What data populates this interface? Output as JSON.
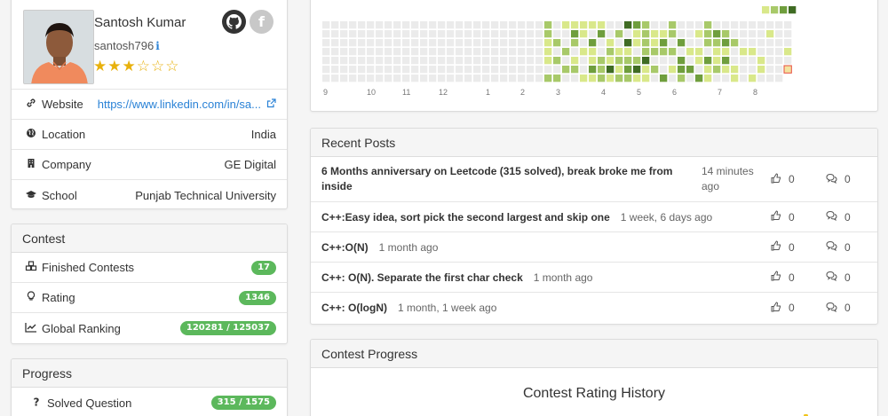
{
  "profile": {
    "real_name": "Santosh Kumar",
    "username": "santosh796",
    "stars": {
      "filled": 3,
      "total": 6
    },
    "rows": [
      {
        "label": "Website",
        "value": "https://www.linkedin.com/in/sa...",
        "icon": "link-icon"
      },
      {
        "label": "Location",
        "value": "India",
        "icon": "globe-icon"
      },
      {
        "label": "Company",
        "value": "GE Digital",
        "icon": "building-icon"
      },
      {
        "label": "School",
        "value": "Punjab Technical University",
        "icon": "graduation-cap-icon"
      }
    ]
  },
  "contest": {
    "heading": "Contest",
    "rows": [
      {
        "label": "Finished Contests",
        "value": "17",
        "icon": "cubes-icon"
      },
      {
        "label": "Rating",
        "value": "1346",
        "icon": "lightbulb-icon"
      },
      {
        "label": "Global Ranking",
        "value": "120281 / 125037",
        "icon": "line-chart-icon"
      }
    ]
  },
  "progress": {
    "heading": "Progress",
    "rows": [
      {
        "label": "Solved Question",
        "value": "315 / 1575",
        "icon": "question-icon"
      }
    ]
  },
  "heatmap": {
    "month_labels": [
      "9",
      "10",
      "11",
      "12",
      "1",
      "2",
      "3",
      "4",
      "5",
      "6",
      "7",
      "8"
    ],
    "colors": [
      "#ebebeb",
      "#d9e88a",
      "#a8c969",
      "#6f9e3d",
      "#3f6b23"
    ]
  },
  "posts": {
    "heading": "Recent Posts",
    "items": [
      {
        "title": "6 Months anniversary on Leetcode (315 solved), break broke me from inside",
        "time": "14 minutes ago",
        "likes": "0",
        "comments": "0"
      },
      {
        "title": "C++:Easy idea, sort pick the second largest and skip one",
        "time": "1 week, 6 days ago",
        "likes": "0",
        "comments": "0"
      },
      {
        "title": "C++:O(N)",
        "time": "1 month ago",
        "likes": "0",
        "comments": "0"
      },
      {
        "title": "C++: O(N). Separate the first char check",
        "time": "1 month ago",
        "likes": "0",
        "comments": "0"
      },
      {
        "title": "C++: O(logN)",
        "time": "1 month, 1 week ago",
        "likes": "0",
        "comments": "0"
      }
    ]
  },
  "contest_progress": {
    "heading": "Contest Progress",
    "chart_title": "Contest Rating History",
    "accent": "#f0c419"
  }
}
